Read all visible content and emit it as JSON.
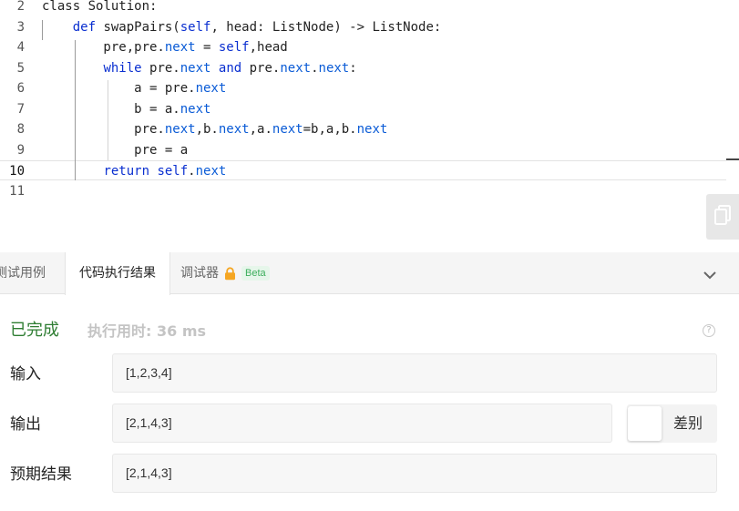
{
  "editor": {
    "lines": [
      {
        "num": "2",
        "code": [
          [
            "class",
            "plain"
          ],
          [
            " Solution:",
            "plain"
          ]
        ]
      },
      {
        "num": "3",
        "code": [
          [
            "    ",
            "plain"
          ],
          [
            "def",
            "kw"
          ],
          [
            " swapPairs(",
            "plain"
          ],
          [
            "self",
            "kw"
          ],
          [
            ", head: ListNode) -> ListNode:",
            "plain"
          ]
        ]
      },
      {
        "num": "4",
        "code": [
          [
            "        pre,pre.",
            "plain"
          ],
          [
            "next",
            "at"
          ],
          [
            " = ",
            "plain"
          ],
          [
            "self",
            "kw"
          ],
          [
            ",head",
            "plain"
          ]
        ]
      },
      {
        "num": "5",
        "code": [
          [
            "        ",
            "plain"
          ],
          [
            "while",
            "kw"
          ],
          [
            " pre.",
            "plain"
          ],
          [
            "next",
            "at"
          ],
          [
            " ",
            "plain"
          ],
          [
            "and",
            "kw"
          ],
          [
            " pre.",
            "plain"
          ],
          [
            "next",
            "at"
          ],
          [
            ".",
            "plain"
          ],
          [
            "next",
            "at"
          ],
          [
            ":",
            "plain"
          ]
        ]
      },
      {
        "num": "6",
        "code": [
          [
            "            a = pre.",
            "plain"
          ],
          [
            "next",
            "at"
          ]
        ]
      },
      {
        "num": "7",
        "code": [
          [
            "            b = a.",
            "plain"
          ],
          [
            "next",
            "at"
          ]
        ]
      },
      {
        "num": "8",
        "code": [
          [
            "            pre.",
            "plain"
          ],
          [
            "next",
            "at"
          ],
          [
            ",b.",
            "plain"
          ],
          [
            "next",
            "at"
          ],
          [
            ",a.",
            "plain"
          ],
          [
            "next",
            "at"
          ],
          [
            "=b,a,b.",
            "plain"
          ],
          [
            "next",
            "at"
          ]
        ]
      },
      {
        "num": "9",
        "code": [
          [
            "            pre = a",
            "plain"
          ]
        ]
      },
      {
        "num": "10",
        "code": [
          [
            "        ",
            "plain"
          ],
          [
            "return",
            "kw"
          ],
          [
            " ",
            "plain"
          ],
          [
            "self",
            "kw"
          ],
          [
            ".",
            "plain"
          ],
          [
            "next",
            "at"
          ]
        ]
      },
      {
        "num": "11",
        "code": []
      }
    ],
    "current_line": "10",
    "copy_icon": "copy-icon"
  },
  "tabs": {
    "test_case": "测试用例",
    "result": "代码执行结果",
    "debugger": "调试器",
    "debugger_badge": "Beta",
    "lock_icon": "lock-icon",
    "collapse_icon": "chevron-down-icon"
  },
  "result": {
    "status": "已完成",
    "runtime_label": "执行用时:",
    "runtime_value": "36 ms",
    "help_icon": "?",
    "input_label": "输入",
    "input_value": "[1,2,3,4]",
    "output_label": "输出",
    "output_value": "[2,1,4,3]",
    "diff_label": "差别",
    "expected_label": "预期结果",
    "expected_value": "[2,1,4,3]"
  },
  "colors": {
    "keyword": "#0a2fd0",
    "attribute": "#0a5bd6",
    "status_green": "#2e7d32",
    "beta_green": "#3cae5c",
    "lock_orange": "#f5a623"
  }
}
